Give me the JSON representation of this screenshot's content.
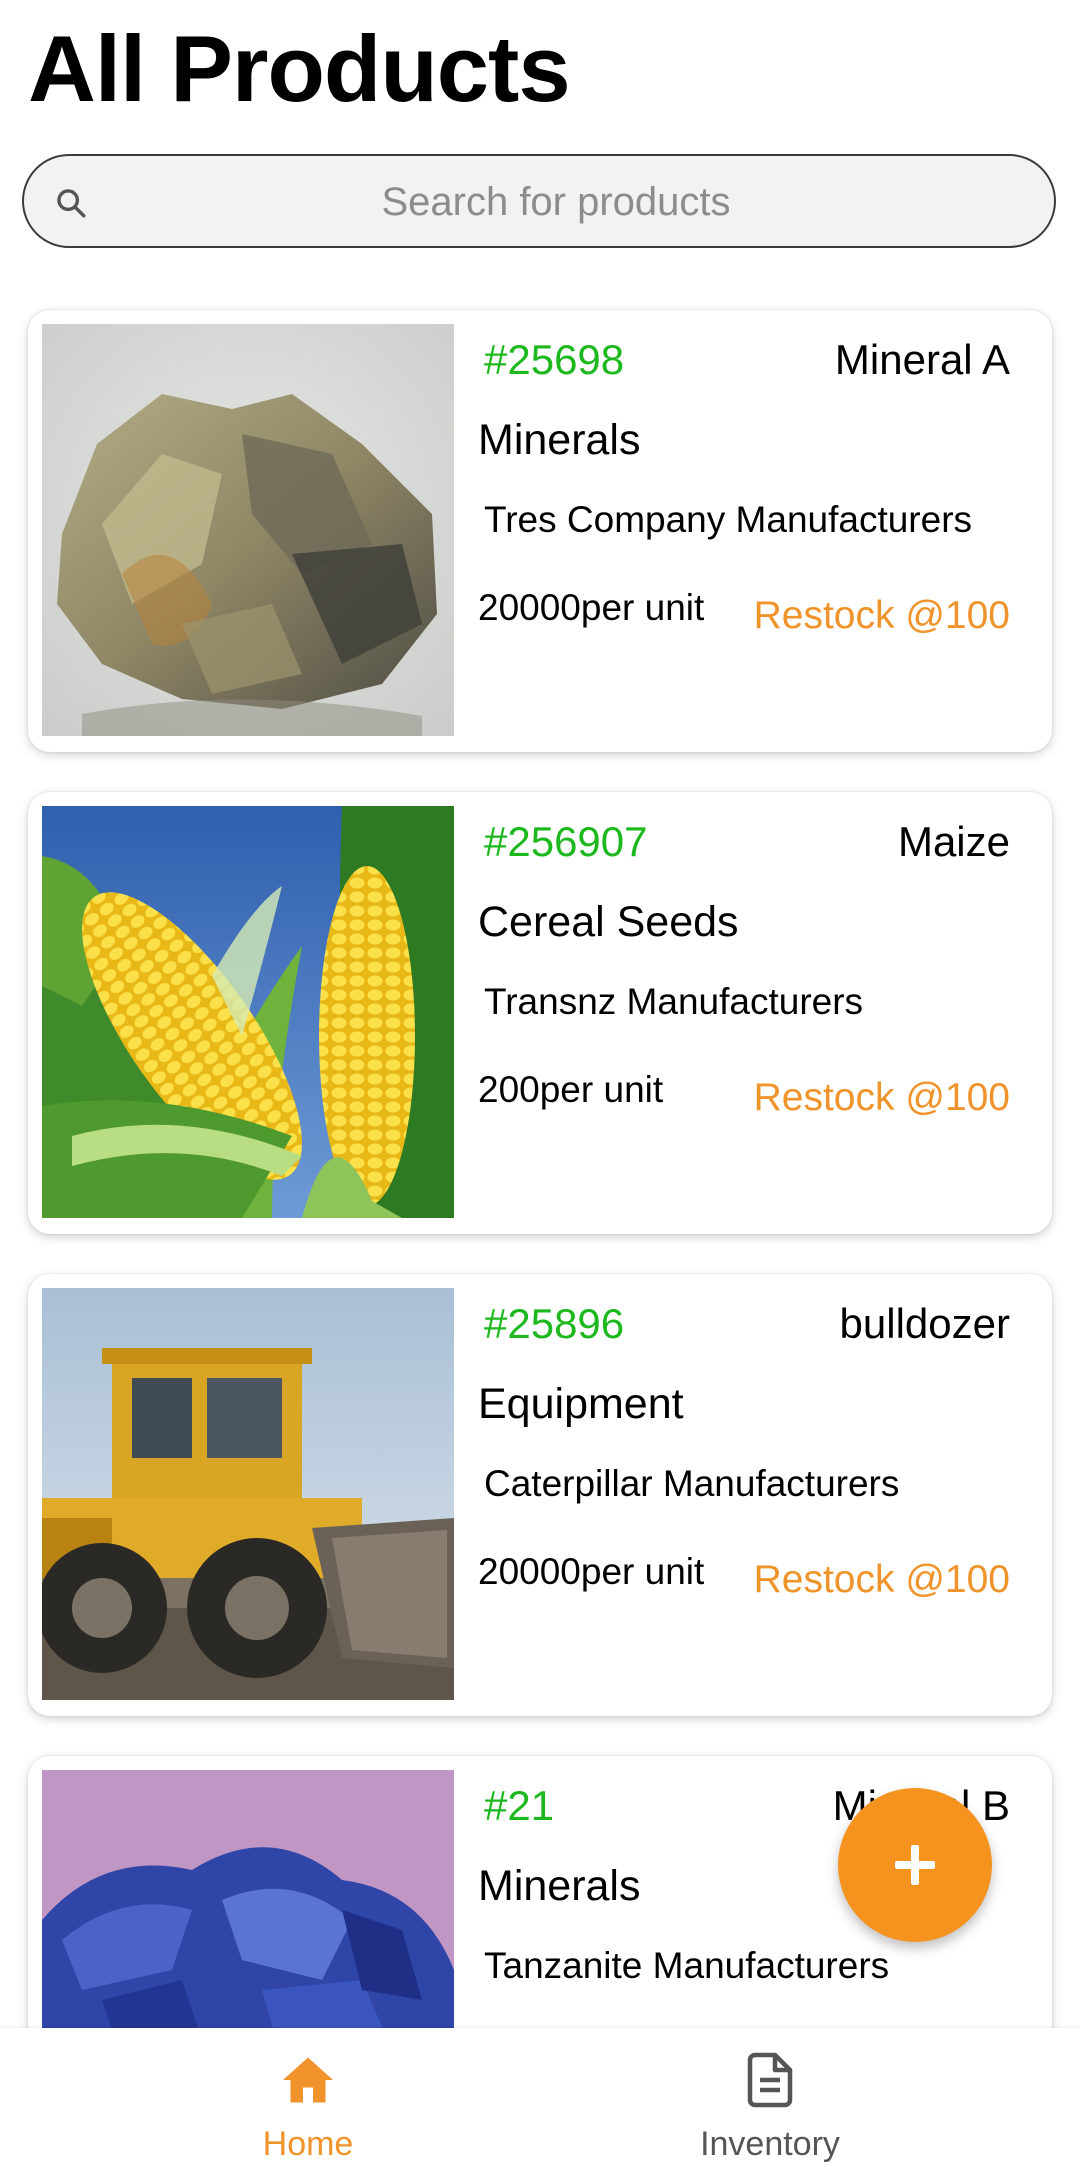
{
  "page": {
    "title": "All Products"
  },
  "search": {
    "placeholder": "Search for products",
    "value": ""
  },
  "products": [
    {
      "id": "#25698",
      "name": "Mineral A",
      "category": "Minerals",
      "manufacturer": "Tres Company Manufacturers",
      "price": "20000per unit",
      "restock": "Restock @100",
      "image": "mineral-rock"
    },
    {
      "id": "#256907",
      "name": "Maize",
      "category": "Cereal Seeds",
      "manufacturer": "Transnz Manufacturers",
      "price": "200per unit",
      "restock": "Restock @100",
      "image": "maize-corn"
    },
    {
      "id": "#25896",
      "name": "bulldozer",
      "category": "Equipment",
      "manufacturer": "Caterpillar Manufacturers",
      "price": "20000per unit",
      "restock": "Restock @100",
      "image": "bulldozer"
    },
    {
      "id": "#21",
      "name": "Mineral B",
      "category": "Minerals",
      "manufacturer": "Tanzanite Manufacturers",
      "image": "blue-mineral"
    }
  ],
  "fab": {
    "label": "+",
    "icon": "plus-icon"
  },
  "bottom_nav": {
    "items": [
      {
        "label": "Home",
        "icon": "home-icon",
        "active": true
      },
      {
        "label": "Inventory",
        "icon": "document-icon",
        "active": false
      }
    ]
  },
  "colors": {
    "accent": "#f6921e",
    "id_green": "#1db81d",
    "restock_orange": "#f0932a"
  }
}
